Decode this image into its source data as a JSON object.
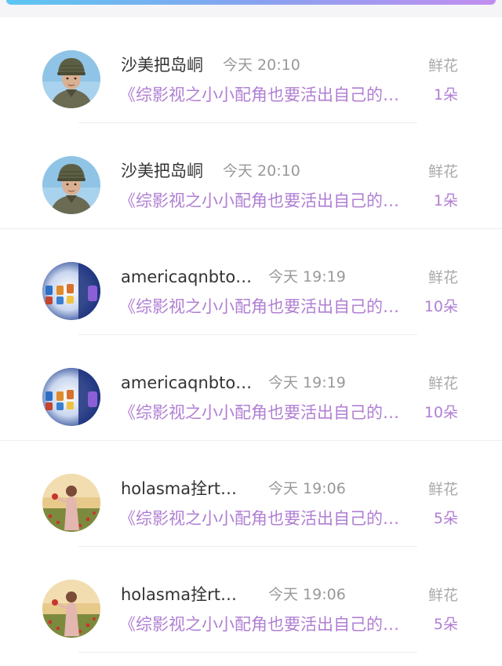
{
  "gift_list": [
    {
      "user_name": "沙美把岛峒",
      "time": "今天 20:10",
      "gift_label": "鲜花",
      "book_title": "《综影视之小小配角也要活出自己的…",
      "count": "1朵",
      "avatar": "soldier-avatar"
    },
    {
      "user_name": "沙美把岛峒",
      "time": "今天 20:10",
      "gift_label": "鲜花",
      "book_title": "《综影视之小小配角也要活出自己的…",
      "count": "1朵",
      "avatar": "soldier-avatar"
    },
    {
      "user_name": "americaqnbto…",
      "time": "今天 19:19",
      "gift_label": "鲜花",
      "book_title": "《综影视之小小配角也要活出自己的…",
      "count": "10朵",
      "avatar": "toys-avatar"
    },
    {
      "user_name": "americaqnbto…",
      "time": "今天 19:19",
      "gift_label": "鲜花",
      "book_title": "《综影视之小小配角也要活出自己的…",
      "count": "10朵",
      "avatar": "toys-avatar"
    },
    {
      "user_name": "holasma拴rt…",
      "time": "今天 19:06",
      "gift_label": "鲜花",
      "book_title": "《综影视之小小配角也要活出自己的…",
      "count": "5朵",
      "avatar": "girl-field-avatar"
    },
    {
      "user_name": "holasma拴rt…",
      "time": "今天 19:06",
      "gift_label": "鲜花",
      "book_title": "《综影视之小小配角也要活出自己的…",
      "count": "5朵",
      "avatar": "girl-field-avatar"
    }
  ],
  "colors": {
    "accent_purple": "#b07fd3",
    "name_text": "#333333",
    "meta_text": "#999999"
  }
}
